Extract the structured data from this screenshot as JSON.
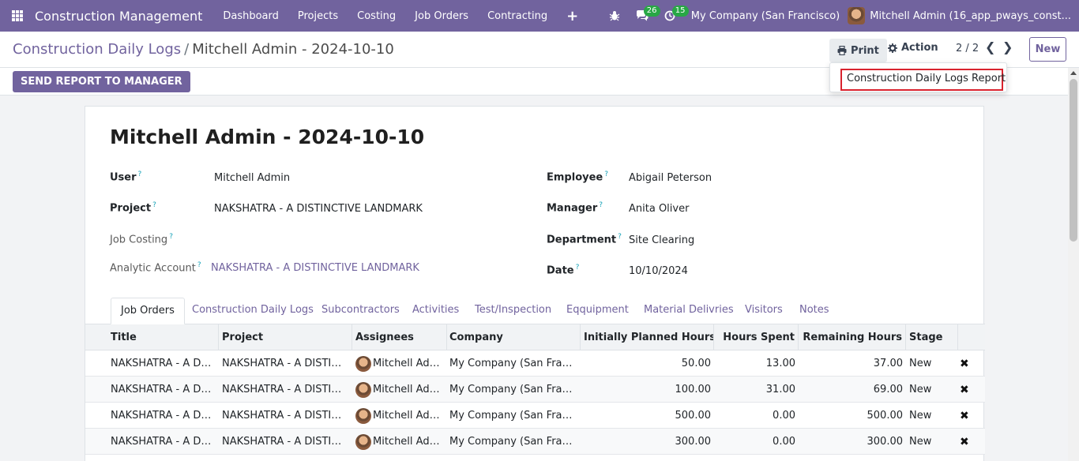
{
  "navbar": {
    "app_title": "Construction Management",
    "menu": [
      "Dashboard",
      "Projects",
      "Costing",
      "Job Orders",
      "Contracting"
    ],
    "plus": "+",
    "messages_count": "26",
    "activities_count": "15",
    "company": "My Company (San Francisco)",
    "user": "Mitchell Admin (16_app_pways_const..."
  },
  "control": {
    "breadcrumb_parent": "Construction Daily Logs",
    "breadcrumb_sep": "/",
    "breadcrumb_current": "Mitchell Admin - 2024-10-10",
    "print_label": "Print",
    "action_label": "Action",
    "pager": "2 / 2",
    "new_label": "New"
  },
  "dropdown": {
    "item": "Construction Daily Logs Report"
  },
  "statusbar": {
    "send_label": "SEND REPORT TO MANAGER"
  },
  "form": {
    "title": "Mitchell Admin - 2024-10-10",
    "user_label": "User",
    "user_value": "Mitchell Admin",
    "project_label": "Project",
    "project_value": "NAKSHATRA - A DISTINCTIVE LANDMARK",
    "job_costing_label": "Job Costing",
    "analytic_label": "Analytic Account",
    "analytic_value": "NAKSHATRA - A DISTINCTIVE LANDMARK",
    "employee_label": "Employee",
    "employee_value": "Abigail Peterson",
    "manager_label": "Manager",
    "manager_value": "Anita Oliver",
    "department_label": "Department",
    "department_value": "Site Clearing",
    "date_label": "Date",
    "date_value": "10/10/2024",
    "help_mark": "?"
  },
  "tabs": [
    "Job Orders",
    "Construction Daily Logs",
    "Subcontractors",
    "Activities",
    "Test/Inspection",
    "Eqquipment",
    "Material Delivries",
    "Visitors",
    "Notes"
  ],
  "table": {
    "headers": {
      "title": "Title",
      "project": "Project",
      "assignees": "Assignees",
      "company": "Company",
      "planned": "Initially Planned Hours",
      "spent": "Hours Spent",
      "remaining": "Remaining Hours",
      "stage": "Stage"
    },
    "rows": [
      {
        "title": "NAKSHATRA - A DIS...",
        "project": "NAKSHATRA - A DISTINC...",
        "assignee": "Mitchell Admin",
        "company": "My Company (San Francis...",
        "planned": "50.00",
        "spent": "13.00",
        "remaining": "37.00",
        "stage": "New"
      },
      {
        "title": "NAKSHATRA - A DIS...",
        "project": "NAKSHATRA - A DISTINC...",
        "assignee": "Mitchell Admin",
        "company": "My Company (San Francis...",
        "planned": "100.00",
        "spent": "31.00",
        "remaining": "69.00",
        "stage": "New"
      },
      {
        "title": "NAKSHATRA - A DIS...",
        "project": "NAKSHATRA - A DISTINC...",
        "assignee": "Mitchell Admin",
        "company": "My Company (San Francis...",
        "planned": "500.00",
        "spent": "0.00",
        "remaining": "500.00",
        "stage": "New"
      },
      {
        "title": "NAKSHATRA - A DIS...",
        "project": "NAKSHATRA - A DISTINC...",
        "assignee": "Mitchell Admin",
        "company": "My Company (San Francis...",
        "planned": "300.00",
        "spent": "0.00",
        "remaining": "300.00",
        "stage": "New"
      }
    ],
    "delete_glyph": "✖"
  }
}
